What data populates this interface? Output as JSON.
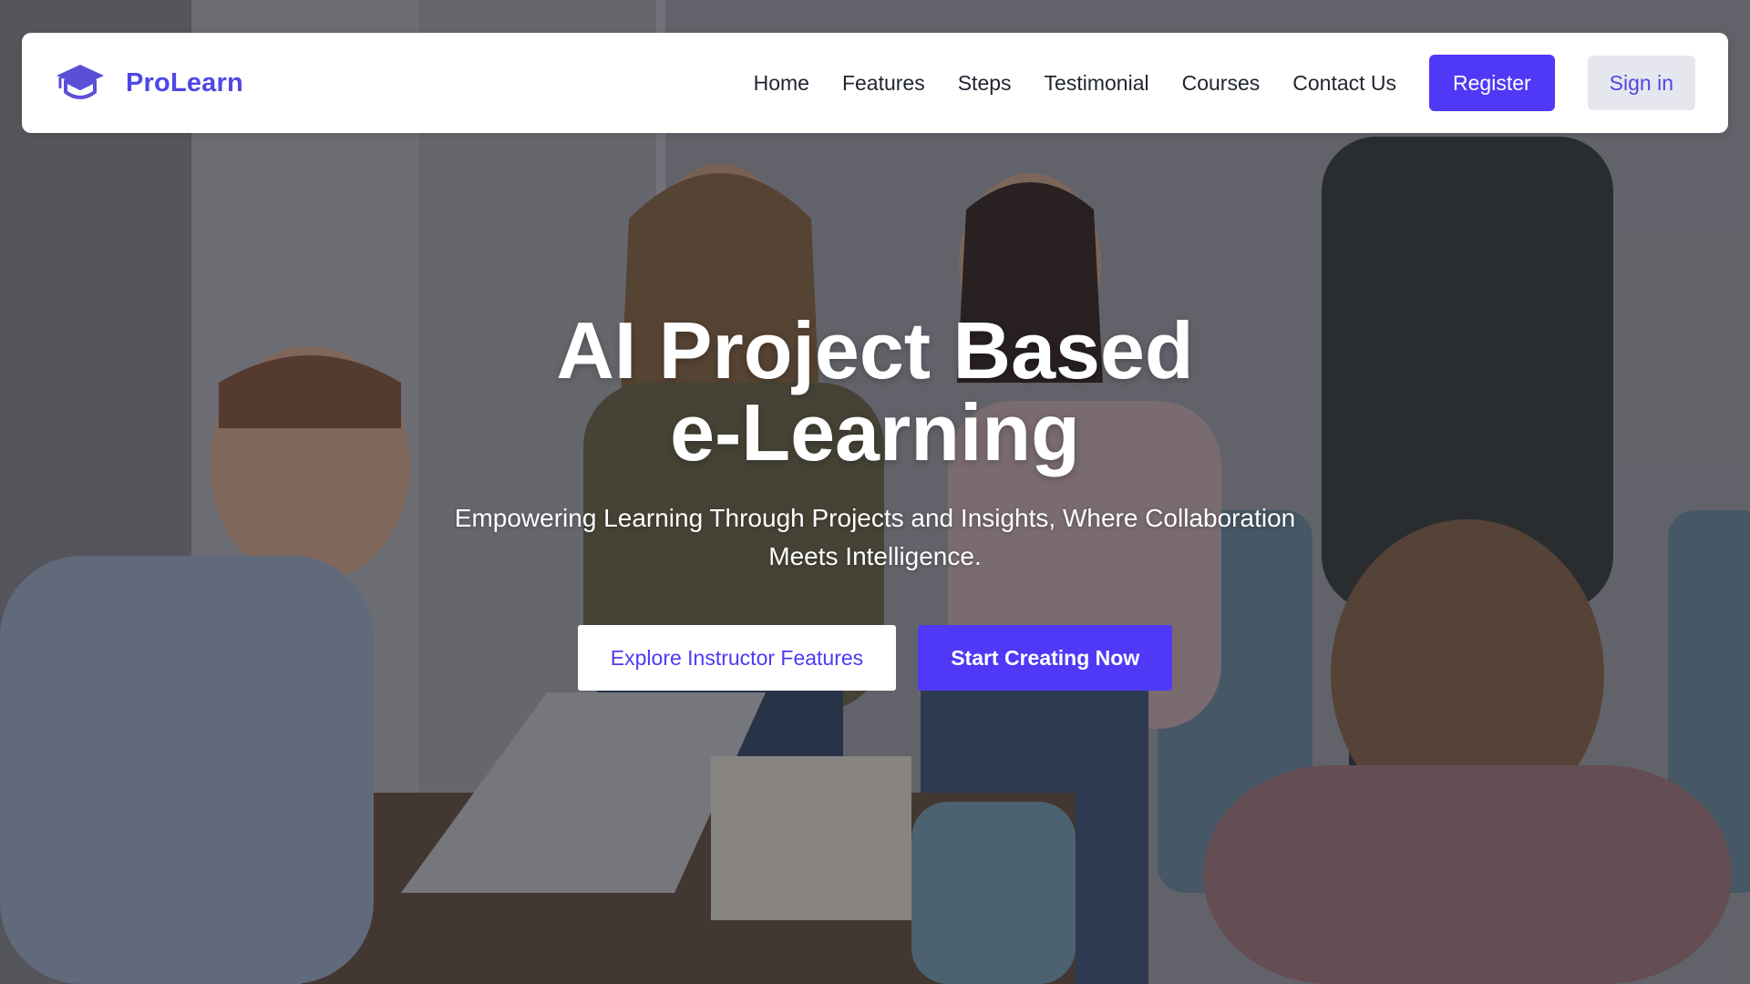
{
  "brand": {
    "name": "ProLearn",
    "icon": "graduation-cap-icon",
    "color": "#4f46e5"
  },
  "nav": {
    "links": [
      "Home",
      "Features",
      "Steps",
      "Testimonial",
      "Courses",
      "Contact Us"
    ],
    "register_label": "Register",
    "signin_label": "Sign in"
  },
  "hero": {
    "title_line1": "AI Project Based",
    "title_line2": "e-Learning",
    "subtitle": "Empowering Learning Through Projects and Insights, Where Collaboration Meets Intelligence.",
    "explore_label": "Explore Instructor Features",
    "start_label": "Start Creating Now",
    "background": "photo-students-classroom"
  },
  "colors": {
    "accent": "#4f39f6",
    "signin_bg": "#e6e7ee",
    "text_dark": "#1f2430"
  }
}
